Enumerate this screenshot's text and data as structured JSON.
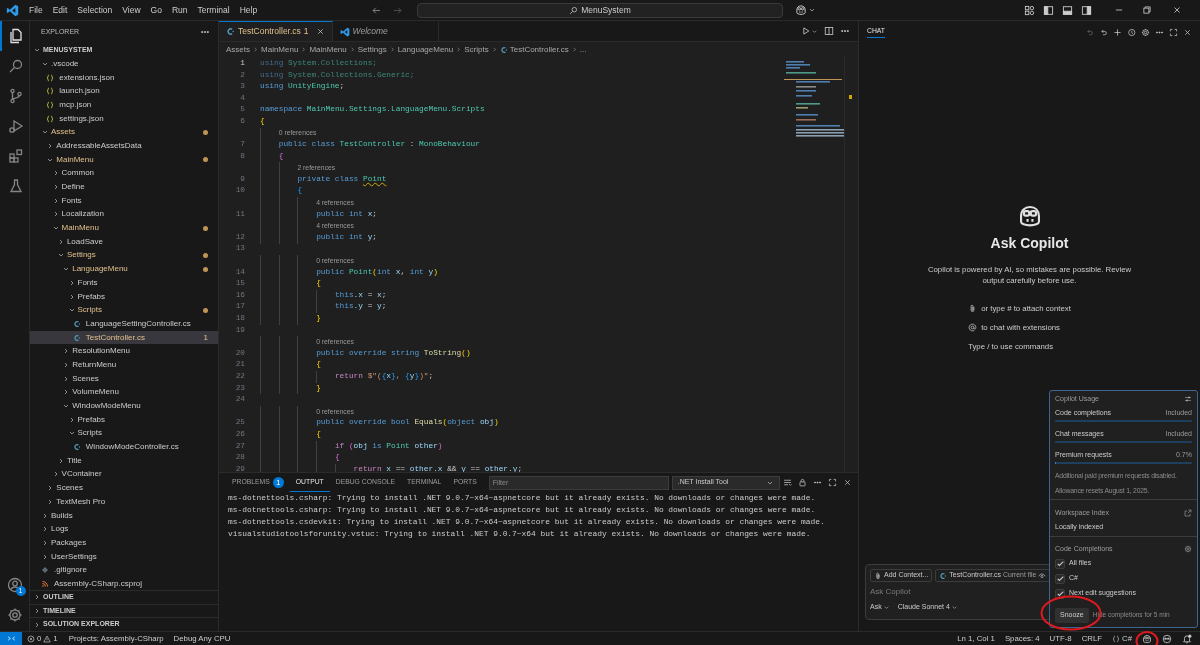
{
  "title_bar": {
    "menu": [
      "File",
      "Edit",
      "Selection",
      "View",
      "Go",
      "Run",
      "Terminal",
      "Help"
    ],
    "search": "MenuSystem"
  },
  "activity_bar": {
    "items": [
      {
        "kind": "explorer",
        "selected": true
      },
      {
        "kind": "search",
        "selected": false
      },
      {
        "kind": "source-control",
        "selected": false
      },
      {
        "kind": "run",
        "selected": false
      },
      {
        "kind": "extensions",
        "selected": false
      },
      {
        "kind": "testing",
        "selected": false
      }
    ],
    "accounts_badge": "1"
  },
  "explorer": {
    "title": "EXPLORER",
    "root": "MENUSYSTEM",
    "tree": [
      {
        "label": ".vscode",
        "kind": "folder",
        "expanded": true,
        "modified": false,
        "selected": false,
        "children": [
          {
            "label": "extensions.json",
            "kind": "json",
            "modified": false,
            "selected": false
          },
          {
            "label": "launch.json",
            "kind": "json",
            "modified": false,
            "selected": false
          },
          {
            "label": "mcp.json",
            "kind": "json",
            "modified": false,
            "selected": false
          },
          {
            "label": "settings.json",
            "kind": "json",
            "modified": false,
            "selected": false
          }
        ]
      },
      {
        "label": "Assets",
        "kind": "folder",
        "expanded": true,
        "modified": true,
        "selected": false,
        "children": [
          {
            "label": "AddressableAssetsData",
            "kind": "folder",
            "expanded": false,
            "modified": false,
            "selected": false
          },
          {
            "label": "MainMenu",
            "kind": "folder",
            "expanded": true,
            "modified": true,
            "selected": false,
            "children": [
              {
                "label": "Common",
                "kind": "folder",
                "expanded": false,
                "modified": false,
                "selected": false
              },
              {
                "label": "Define",
                "kind": "folder",
                "expanded": false,
                "modified": false,
                "selected": false
              },
              {
                "label": "Fonts",
                "kind": "folder",
                "expanded": false,
                "modified": false,
                "selected": false
              },
              {
                "label": "Localization",
                "kind": "folder",
                "expanded": false,
                "modified": false,
                "selected": false
              },
              {
                "label": "MainMenu",
                "kind": "folder",
                "expanded": true,
                "modified": true,
                "selected": false,
                "children": [
                  {
                    "label": "LoadSave",
                    "kind": "folder",
                    "expanded": false,
                    "modified": false,
                    "selected": false
                  },
                  {
                    "label": "Settings",
                    "kind": "folder",
                    "expanded": true,
                    "modified": true,
                    "selected": false,
                    "children": [
                      {
                        "label": "LanguageMenu",
                        "kind": "folder",
                        "expanded": true,
                        "modified": true,
                        "selected": false,
                        "children": [
                          {
                            "label": "Fonts",
                            "kind": "folder",
                            "expanded": false,
                            "modified": false,
                            "selected": false
                          },
                          {
                            "label": "Prefabs",
                            "kind": "folder",
                            "expanded": false,
                            "modified": false,
                            "selected": false
                          },
                          {
                            "label": "Scripts",
                            "kind": "folder",
                            "expanded": true,
                            "modified": true,
                            "selected": false,
                            "children": [
                              {
                                "label": "LanguageSettingController.cs",
                                "kind": "cs",
                                "modified": false,
                                "selected": false
                              },
                              {
                                "label": "TestController.cs",
                                "kind": "cs",
                                "modified": false,
                                "selected": true,
                                "problems": "1"
                              }
                            ]
                          }
                        ]
                      },
                      {
                        "label": "ResolutionMenu",
                        "kind": "folder",
                        "expanded": false,
                        "modified": false,
                        "selected": false
                      },
                      {
                        "label": "ReturnMenu",
                        "kind": "folder",
                        "expanded": false,
                        "modified": false,
                        "selected": false
                      },
                      {
                        "label": "Scenes",
                        "kind": "folder",
                        "expanded": false,
                        "modified": false,
                        "selected": false
                      },
                      {
                        "label": "VolumeMenu",
                        "kind": "folder",
                        "expanded": false,
                        "modified": false,
                        "selected": false
                      },
                      {
                        "label": "WindowModeMenu",
                        "kind": "folder",
                        "expanded": true,
                        "modified": false,
                        "selected": false,
                        "children": [
                          {
                            "label": "Prefabs",
                            "kind": "folder",
                            "expanded": false,
                            "modified": false,
                            "selected": false
                          },
                          {
                            "label": "Scripts",
                            "kind": "folder",
                            "expanded": true,
                            "modified": false,
                            "selected": false,
                            "children": [
                              {
                                "label": "WindowModeController.cs",
                                "kind": "cs",
                                "modified": false,
                                "selected": false
                              }
                            ]
                          }
                        ]
                      }
                    ]
                  },
                  {
                    "label": "Title",
                    "kind": "folder",
                    "expanded": false,
                    "modified": false,
                    "selected": false
                  }
                ]
              },
              {
                "label": "VContainer",
                "kind": "folder",
                "expanded": false,
                "modified": false,
                "selected": false
              }
            ]
          },
          {
            "label": "Scenes",
            "kind": "folder",
            "expanded": false,
            "modified": false,
            "selected": false
          },
          {
            "label": "TextMesh Pro",
            "kind": "folder",
            "expanded": false,
            "modified": false,
            "selected": false
          }
        ]
      },
      {
        "label": "Builds",
        "kind": "folder",
        "expanded": false,
        "modified": false,
        "selected": false
      },
      {
        "label": "Logs",
        "kind": "folder",
        "expanded": false,
        "modified": false,
        "selected": false
      },
      {
        "label": "Packages",
        "kind": "folder",
        "expanded": false,
        "modified": false,
        "selected": false
      },
      {
        "label": "UserSettings",
        "kind": "folder",
        "expanded": false,
        "modified": false,
        "selected": false
      },
      {
        "label": ".gitignore",
        "kind": "gitignore",
        "modified": false,
        "selected": false
      },
      {
        "label": "Assembly-CSharp.csproj",
        "kind": "csproj",
        "modified": false,
        "selected": false
      }
    ],
    "sections": [
      "OUTLINE",
      "TIMELINE",
      "SOLUTION EXPLORER"
    ]
  },
  "editor": {
    "tabs": [
      {
        "label": "TestController.cs",
        "kind": "cs",
        "problems": "1",
        "preview": false,
        "selected": true
      },
      {
        "label": "Welcome",
        "kind": "vscode",
        "preview": true,
        "selected": false
      }
    ],
    "breadcrumb": [
      "Assets",
      "MainMenu",
      "MainMenu",
      "Settings",
      "LanguageMenu",
      "Scripts",
      "TestController.cs",
      "..."
    ],
    "lines": [
      {
        "kind": "code",
        "number": "1",
        "current": true,
        "tokens": [
          {
            "kind": "dimkw",
            "text": "using"
          },
          {
            "kind": "dimns",
            "text": " System.Collections;"
          }
        ]
      },
      {
        "kind": "code",
        "number": "2",
        "current": false,
        "tokens": [
          {
            "kind": "dimkw",
            "text": "using"
          },
          {
            "kind": "dimns",
            "text": " System.Collections.Generic;"
          }
        ]
      },
      {
        "kind": "code",
        "number": "3",
        "current": false,
        "tokens": [
          {
            "kind": "kw",
            "text": "using"
          },
          {
            "kind": "type",
            "text": " UnityEngine"
          },
          {
            "kind": "plain",
            "text": ";"
          }
        ]
      },
      {
        "kind": "code",
        "number": "4",
        "current": false
      },
      {
        "kind": "code",
        "number": "5",
        "current": false,
        "tokens": [
          {
            "kind": "kw",
            "text": "namespace"
          },
          {
            "kind": "type",
            "text": " MainMenu.Settings.LanguageMenu.Scripts"
          }
        ]
      },
      {
        "kind": "code",
        "number": "6",
        "current": false,
        "tokens": [
          {
            "kind": "b1",
            "text": "{"
          }
        ]
      },
      {
        "kind": "lens",
        "text": "    0 references"
      },
      {
        "kind": "code",
        "number": "7",
        "current": false,
        "tokens": [
          {
            "kind": "kw",
            "text": "    public class"
          },
          {
            "kind": "type",
            "text": " TestController"
          },
          {
            "kind": "plain",
            "text": " : "
          },
          {
            "kind": "type",
            "text": "MonoBehaviour"
          }
        ]
      },
      {
        "kind": "code",
        "number": "8",
        "current": false,
        "tokens": [
          {
            "kind": "b2",
            "text": "    {"
          }
        ]
      },
      {
        "kind": "lens",
        "text": "        2 references"
      },
      {
        "kind": "code",
        "number": "9",
        "current": false,
        "tokens": [
          {
            "kind": "kw",
            "text": "        private class "
          },
          {
            "kind": "typewarn",
            "text": "Point"
          }
        ]
      },
      {
        "kind": "code",
        "number": "10",
        "current": false,
        "tokens": [
          {
            "kind": "b3",
            "text": "        {"
          }
        ]
      },
      {
        "kind": "lens",
        "text": "            4 references"
      },
      {
        "kind": "code",
        "number": "11",
        "current": false,
        "tokens": [
          {
            "kind": "kw",
            "text": "            public int"
          },
          {
            "kind": "var",
            "text": " x"
          },
          {
            "kind": "plain",
            "text": ";"
          }
        ]
      },
      {
        "kind": "lens",
        "text": "            4 references"
      },
      {
        "kind": "code",
        "number": "12",
        "current": false,
        "tokens": [
          {
            "kind": "kw",
            "text": "            public int"
          },
          {
            "kind": "var",
            "text": " y"
          },
          {
            "kind": "plain",
            "text": ";"
          }
        ]
      },
      {
        "kind": "code",
        "number": "13",
        "current": false
      },
      {
        "kind": "lens",
        "text": "            0 references"
      },
      {
        "kind": "code",
        "number": "14",
        "current": false,
        "tokens": [
          {
            "kind": "kw",
            "text": "            public"
          },
          {
            "kind": "type",
            "text": " Point"
          },
          {
            "kind": "b1",
            "text": "("
          },
          {
            "kind": "kw",
            "text": "int"
          },
          {
            "kind": "var",
            "text": " x"
          },
          {
            "kind": "plain",
            "text": ", "
          },
          {
            "kind": "kw",
            "text": "int"
          },
          {
            "kind": "var",
            "text": " y"
          },
          {
            "kind": "b1",
            "text": ")"
          }
        ]
      },
      {
        "kind": "code",
        "number": "15",
        "current": false,
        "tokens": [
          {
            "kind": "b1",
            "text": "            {"
          }
        ]
      },
      {
        "kind": "code",
        "number": "16",
        "current": false,
        "tokens": [
          {
            "kind": "kw",
            "text": "                this"
          },
          {
            "kind": "plain",
            "text": "."
          },
          {
            "kind": "var",
            "text": "x"
          },
          {
            "kind": "plain",
            "text": " = "
          },
          {
            "kind": "var",
            "text": "x"
          },
          {
            "kind": "plain",
            "text": ";"
          }
        ]
      },
      {
        "kind": "code",
        "number": "17",
        "current": false,
        "tokens": [
          {
            "kind": "kw",
            "text": "                this"
          },
          {
            "kind": "plain",
            "text": "."
          },
          {
            "kind": "var",
            "text": "y"
          },
          {
            "kind": "plain",
            "text": " = "
          },
          {
            "kind": "var",
            "text": "y"
          },
          {
            "kind": "plain",
            "text": ";"
          }
        ]
      },
      {
        "kind": "code",
        "number": "18",
        "current": false,
        "tokens": [
          {
            "kind": "b1",
            "text": "            }"
          }
        ]
      },
      {
        "kind": "code",
        "number": "19",
        "current": false
      },
      {
        "kind": "lens",
        "text": "            0 references"
      },
      {
        "kind": "code",
        "number": "20",
        "current": false,
        "tokens": [
          {
            "kind": "kw",
            "text": "            public override string"
          },
          {
            "kind": "fn",
            "text": " ToString"
          },
          {
            "kind": "b1",
            "text": "()"
          }
        ]
      },
      {
        "kind": "code",
        "number": "21",
        "current": false,
        "tokens": [
          {
            "kind": "b1",
            "text": "            {"
          }
        ]
      },
      {
        "kind": "code",
        "number": "22",
        "current": false,
        "tokens": [
          {
            "kind": "ctrl",
            "text": "                return"
          },
          {
            "kind": "str",
            "text": " $\"("
          },
          {
            "kind": "b3",
            "text": "{"
          },
          {
            "kind": "var",
            "text": "x"
          },
          {
            "kind": "b3",
            "text": "}"
          },
          {
            "kind": "str",
            "text": ", "
          },
          {
            "kind": "b3",
            "text": "{"
          },
          {
            "kind": "var",
            "text": "y"
          },
          {
            "kind": "b3",
            "text": "}"
          },
          {
            "kind": "str",
            "text": ")\""
          },
          {
            "kind": "plain",
            "text": ";"
          }
        ]
      },
      {
        "kind": "code",
        "number": "23",
        "current": false,
        "tokens": [
          {
            "kind": "b1",
            "text": "            }"
          }
        ]
      },
      {
        "kind": "code",
        "number": "24",
        "current": false
      },
      {
        "kind": "lens",
        "text": "            0 references"
      },
      {
        "kind": "code",
        "number": "25",
        "current": false,
        "tokens": [
          {
            "kind": "kw",
            "text": "            public override bool"
          },
          {
            "kind": "fn",
            "text": " Equals"
          },
          {
            "kind": "b1",
            "text": "("
          },
          {
            "kind": "kw",
            "text": "object"
          },
          {
            "kind": "var",
            "text": " obj"
          },
          {
            "kind": "b1",
            "text": ")"
          }
        ]
      },
      {
        "kind": "code",
        "number": "26",
        "current": false,
        "tokens": [
          {
            "kind": "b1",
            "text": "            {"
          }
        ]
      },
      {
        "kind": "code",
        "number": "27",
        "current": false,
        "tokens": [
          {
            "kind": "ctrl",
            "text": "                if"
          },
          {
            "kind": "b2",
            "text": " ("
          },
          {
            "kind": "var",
            "text": "obj"
          },
          {
            "kind": "kw",
            "text": " is"
          },
          {
            "kind": "type",
            "text": " Point"
          },
          {
            "kind": "var",
            "text": " other"
          },
          {
            "kind": "b2",
            "text": ")"
          }
        ]
      },
      {
        "kind": "code",
        "number": "28",
        "current": false,
        "tokens": [
          {
            "kind": "b2",
            "text": "                {"
          }
        ]
      },
      {
        "kind": "code",
        "number": "29",
        "current": false,
        "tokens": [
          {
            "kind": "ctrl",
            "text": "                    return"
          },
          {
            "kind": "var",
            "text": " x"
          },
          {
            "kind": "plain",
            "text": " == "
          },
          {
            "kind": "var",
            "text": "other"
          },
          {
            "kind": "plain",
            "text": "."
          },
          {
            "kind": "var",
            "text": "x"
          },
          {
            "kind": "plain",
            "text": " && "
          },
          {
            "kind": "var",
            "text": "y"
          },
          {
            "kind": "plain",
            "text": " == "
          },
          {
            "kind": "var",
            "text": "other"
          },
          {
            "kind": "plain",
            "text": "."
          },
          {
            "kind": "var",
            "text": "y"
          },
          {
            "kind": "plain",
            "text": ";"
          }
        ]
      }
    ]
  },
  "panel": {
    "tabs": [
      {
        "label": "PROBLEMS",
        "badge": "1",
        "selected": false
      },
      {
        "label": "OUTPUT",
        "selected": true
      },
      {
        "label": "DEBUG CONSOLE",
        "selected": false
      },
      {
        "label": "TERMINAL",
        "selected": false
      },
      {
        "label": "PORTS",
        "selected": false
      }
    ],
    "filter_placeholder": "Filter",
    "channel": ".NET Install Tool",
    "output": [
      "ms-dotnettools.csharp: Trying to install .NET 9.0.7~x64~aspnetcore but it already exists. No downloads or changes were made.",
      "ms-dotnettools.csharp: Trying to install .NET 9.0.7~x64~aspnetcore but it already exists. No downloads or changes were made.",
      "ms-dotnettools.csdevkit: Trying to install .NET 9.0.7~x64~aspnetcore but it already exists. No downloads or changes were made.",
      "visualstudiotoolsforunity.vstuc: Trying to install .NET 9.0.7~x64 but it already exists. No downloads or changes were made."
    ]
  },
  "chat": {
    "title": "CHAT",
    "heading": "Ask Copilot",
    "description": "Copilot is powered by AI, so mistakes are possible. Review output carefully before use.",
    "hints": [
      {
        "kind": "attach",
        "text": "or type # to attach context"
      },
      {
        "kind": "mention",
        "text": "to chat with extensions"
      },
      {
        "kind": "plain",
        "text": "Type / to use commands"
      }
    ],
    "input": {
      "add_context": "Add Context...",
      "file_chip": "TestController.cs",
      "file_chip_note": "Current file",
      "placeholder": "Ask Copilot",
      "mode": "Ask",
      "model": "Claude Sonnet 4"
    }
  },
  "copilot_popup": {
    "title": "Copilot Usage",
    "usage": [
      {
        "label": "Code completions",
        "value": "Included",
        "level": 0
      },
      {
        "label": "Chat messages",
        "value": "Included",
        "level": 0
      },
      {
        "label": "Premium requests",
        "value": "0.7%",
        "level": 0.007
      }
    ],
    "notes": [
      "Additional paid premium requests disabled.",
      "Allowance resets August 1, 2025."
    ],
    "workspace_title": "Workspace Index",
    "workspace_status": "Locally indexed",
    "completions_title": "Code Completions",
    "options": [
      {
        "label": "All files",
        "checked": true
      },
      {
        "label": "C#",
        "checked": true
      },
      {
        "label": "Next edit suggestions",
        "checked": true
      }
    ],
    "snooze": {
      "label": "Snooze",
      "highlighted": true
    },
    "snooze_hint": "Hide completions for 5 min"
  },
  "status_bar": {
    "errors": "0",
    "warnings": "1",
    "project": "Projects: Assembly-CSharp",
    "config": "Debug Any CPU",
    "right": [
      {
        "kind": "text",
        "text": "Ln 1, Col 1",
        "highlighted": false
      },
      {
        "kind": "text",
        "text": "Spaces: 4",
        "highlighted": false
      },
      {
        "kind": "text",
        "text": "UTF-8",
        "highlighted": false
      },
      {
        "kind": "text",
        "text": "CRLF",
        "highlighted": false
      },
      {
        "kind": "language",
        "text": "C#",
        "highlighted": false
      },
      {
        "kind": "copilot",
        "highlighted": true
      },
      {
        "kind": "copilot-chat",
        "highlighted": false
      },
      {
        "kind": "bell",
        "highlighted": false
      }
    ]
  }
}
